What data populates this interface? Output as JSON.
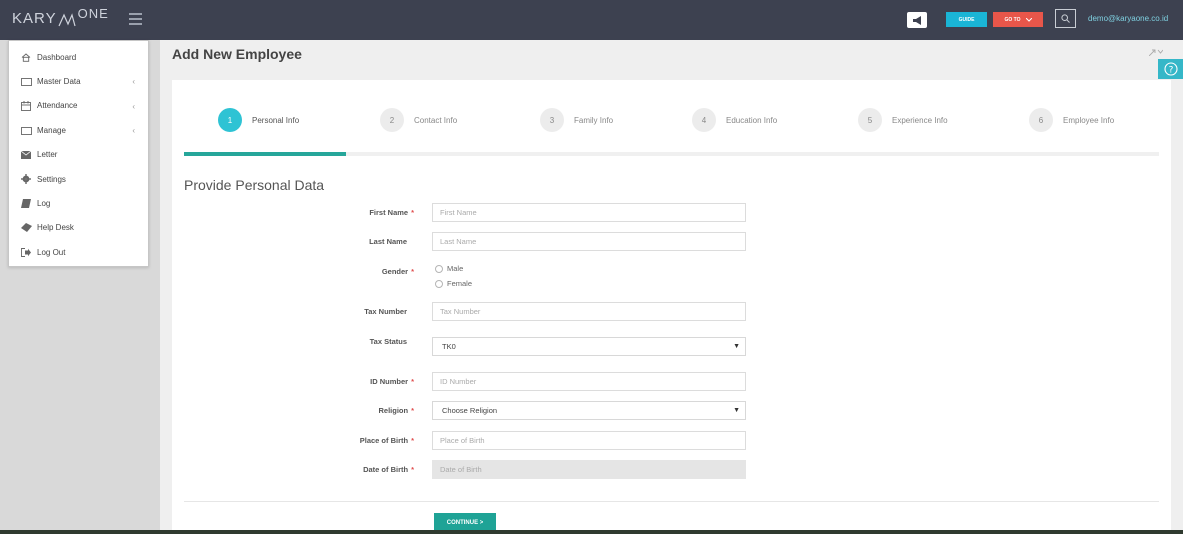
{
  "topbar": {
    "logo_main": "KARY",
    "logo_one": "ONE",
    "guide_label": "GUIDE",
    "goto_label": "GO TO",
    "user_email": "demo@karyaone.co.id"
  },
  "sidebar": {
    "items": [
      {
        "label": "Dashboard",
        "icon": "home-icon"
      },
      {
        "label": "Master Data",
        "icon": "folder-icon",
        "chevron": "‹"
      },
      {
        "label": "Attendance",
        "icon": "calendar-icon",
        "chevron": "‹"
      },
      {
        "label": "Manage",
        "icon": "folder-icon",
        "chevron": "‹"
      },
      {
        "label": "Letter",
        "icon": "envelope-icon"
      },
      {
        "label": "Settings",
        "icon": "gear-icon"
      },
      {
        "label": "Log",
        "icon": "book-icon"
      },
      {
        "label": "Help Desk",
        "icon": "ticket-icon"
      },
      {
        "label": "Log Out",
        "icon": "logout-icon"
      }
    ]
  },
  "page": {
    "title": "Add New Employee"
  },
  "steps": [
    {
      "num": "1",
      "label": "Personal Info"
    },
    {
      "num": "2",
      "label": "Contact Info"
    },
    {
      "num": "3",
      "label": "Family Info"
    },
    {
      "num": "4",
      "label": "Education Info"
    },
    {
      "num": "5",
      "label": "Experience Info"
    },
    {
      "num": "6",
      "label": "Employee Info"
    }
  ],
  "form": {
    "section_title": "Provide Personal Data",
    "required_mark": "*",
    "first_name": {
      "label": "First Name",
      "placeholder": "First Name"
    },
    "last_name": {
      "label": "Last Name",
      "placeholder": "Last Name"
    },
    "gender": {
      "label": "Gender",
      "options": [
        "Male",
        "Female"
      ]
    },
    "tax_number": {
      "label": "Tax Number",
      "placeholder": "Tax Number"
    },
    "tax_status": {
      "label": "Tax Status",
      "value": "TK0"
    },
    "id_number": {
      "label": "ID Number",
      "placeholder": "ID Number"
    },
    "religion": {
      "label": "Religion",
      "value": "Choose Religion"
    },
    "place_of_birth": {
      "label": "Place of Birth",
      "placeholder": "Place of Birth"
    },
    "date_of_birth": {
      "label": "Date of Birth",
      "placeholder": "Date of Birth"
    },
    "continue_label": "CONTINUE >"
  }
}
